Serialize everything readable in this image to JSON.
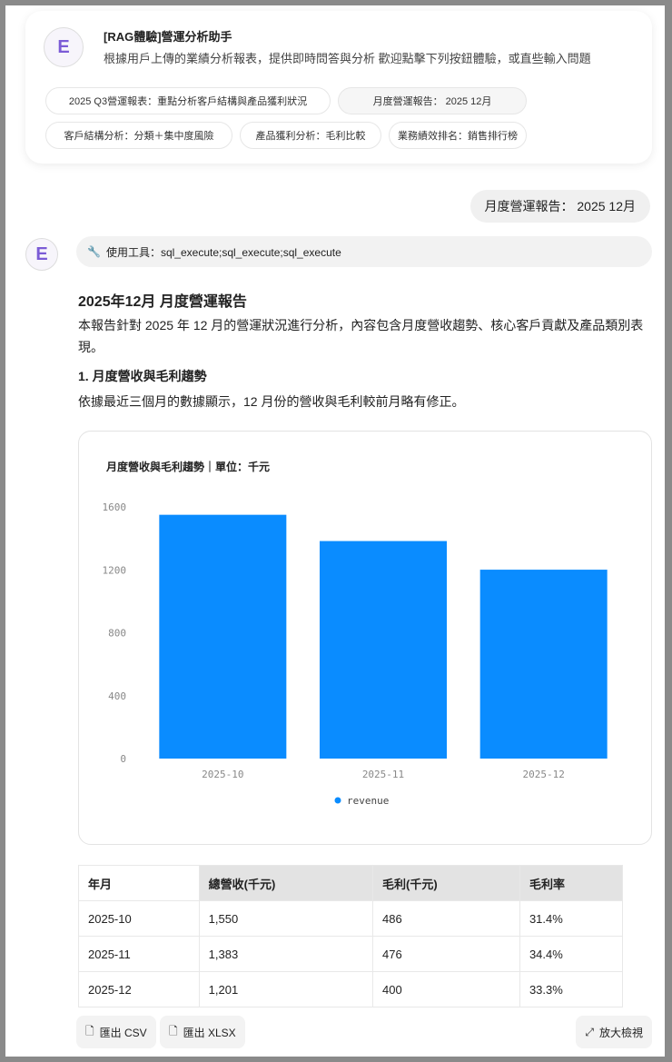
{
  "header": {
    "title": "[RAG體驗]營運分析助手",
    "subtitle": "根據用戶上傳的業績分析報表，提供即時問答與分析 歡迎點擊下列按鈕體驗，或直些輸入問題"
  },
  "chips": [
    "2025 Q3營運報表：重點分析客戶結構與產品獲利狀況",
    "月度營運報告： 2025 12月",
    "客戶結構分析：分類＋集中度風險",
    "產品獲利分析：毛利比較",
    "業務績效排名：銷售排行榜"
  ],
  "user_message": "月度營運報告： 2025 12月",
  "tool_usage": "使用工具：sql_execute;sql_execute;sql_execute",
  "report": {
    "title": "2025年12月 月度營運報告",
    "intro": "本報告針對 2025 年 12 月的營運狀況進行分析，內容包含月度營收趨勢、核心客戶貢獻及產品類別表現。",
    "section1": "1. 月度營收與毛利趨勢",
    "section1_text": "依據最近三個月的數據顯示，12 月份的營收與毛利較前月略有修正。"
  },
  "chart_data": {
    "type": "bar",
    "title": "月度營收與毛利趨勢｜單位：千元",
    "categories": [
      "2025-10",
      "2025-11",
      "2025-12"
    ],
    "series": [
      {
        "name": "revenue",
        "values": [
          1550,
          1383,
          1201
        ]
      }
    ],
    "ylim": [
      0,
      1600
    ],
    "yticks": [
      "0",
      "400",
      "800",
      "1200",
      "1600"
    ],
    "legend": "bottom",
    "color": "#0a8cff"
  },
  "table": {
    "headers": [
      "年月",
      "總營收(千元)",
      "毛利(千元)",
      "毛利率"
    ],
    "rows": [
      [
        "2025-10",
        "1,550",
        "486",
        "31.4%"
      ],
      [
        "2025-11",
        "1,383",
        "476",
        "34.4%"
      ],
      [
        "2025-12",
        "1,201",
        "400",
        "33.3%"
      ]
    ]
  },
  "buttons": {
    "csv": "匯出 CSV",
    "xlsx": "匯出 XLSX",
    "expand": "放大檢視"
  }
}
